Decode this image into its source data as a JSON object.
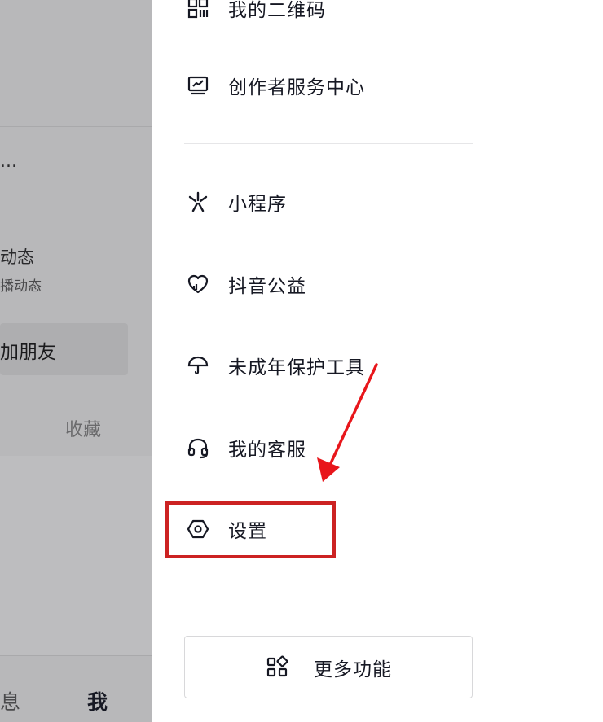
{
  "background": {
    "truncated_name": "...",
    "dynamic_label": "动态",
    "dynamic_sub": "播动态",
    "add_friends": "加朋友",
    "favorites_tab": "收藏",
    "nav_messages": "息",
    "nav_me": "我"
  },
  "drawer": {
    "items": [
      {
        "label": "我的二维码",
        "icon": "qr-code-icon"
      },
      {
        "label": "创作者服务中心",
        "icon": "monitor-chart-icon"
      },
      {
        "label": "小程序",
        "icon": "mini-program-icon"
      },
      {
        "label": "抖音公益",
        "icon": "charity-heart-icon"
      },
      {
        "label": "未成年保护工具",
        "icon": "umbrella-icon"
      },
      {
        "label": "我的客服",
        "icon": "headset-icon"
      },
      {
        "label": "设置",
        "icon": "settings-hexagon-icon"
      }
    ],
    "more_button": {
      "label": "更多功能",
      "icon": "grid-icon"
    }
  },
  "annotation": {
    "color": "#cc2222"
  }
}
